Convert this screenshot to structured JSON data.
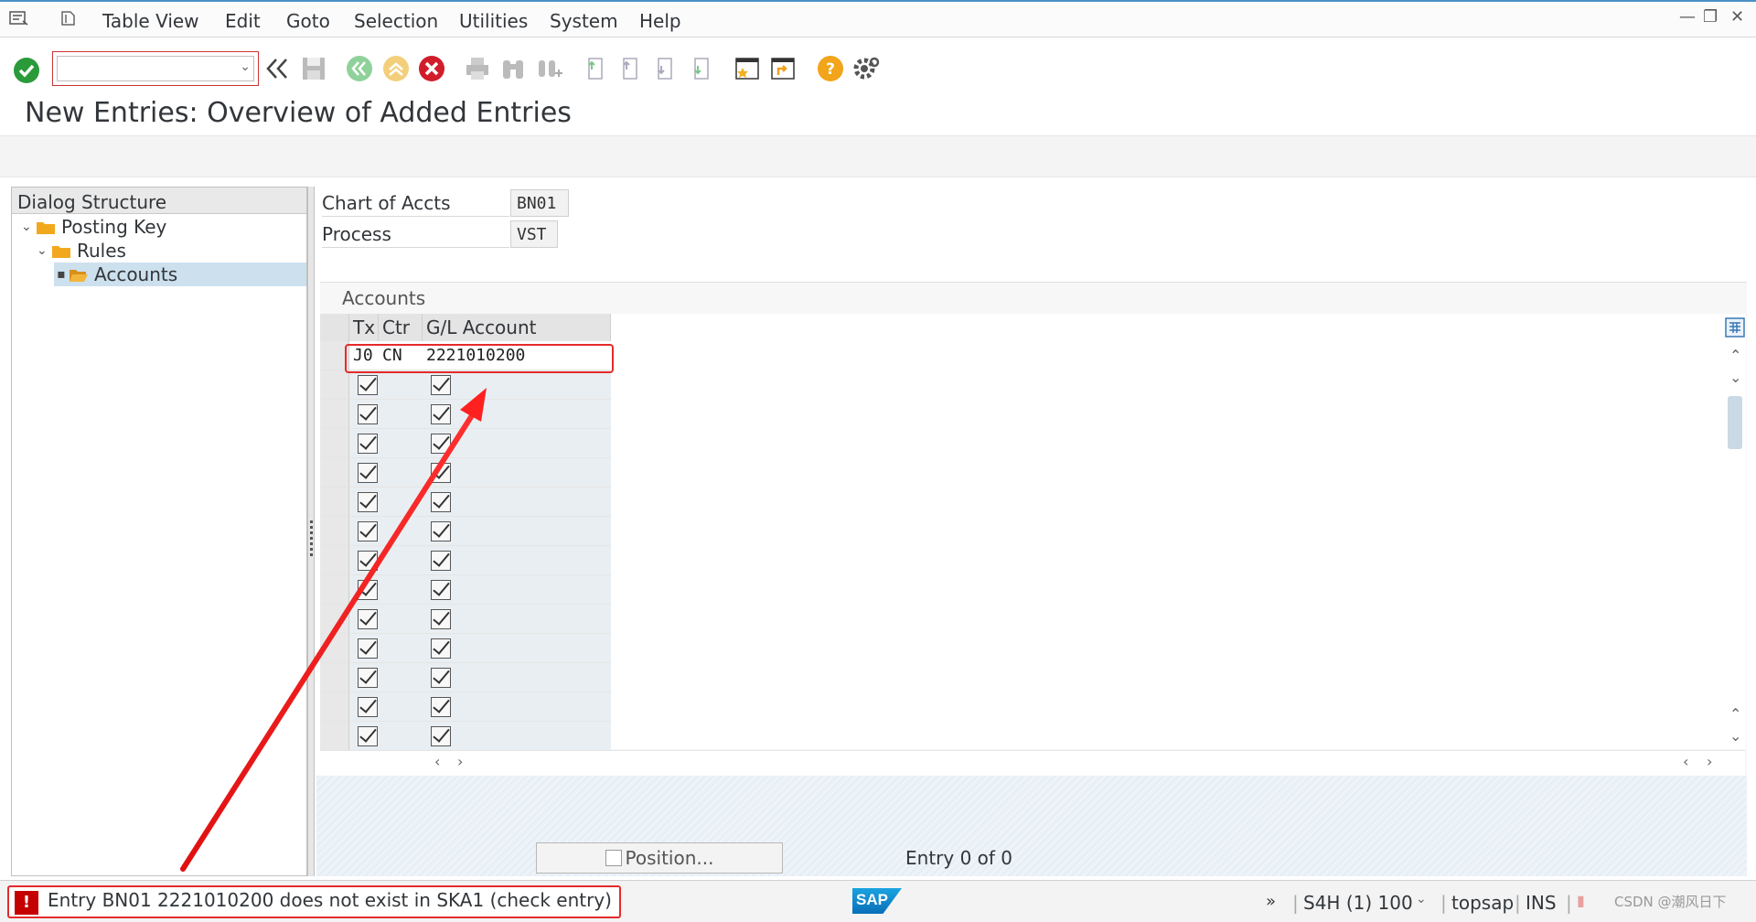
{
  "menu": {
    "items": [
      "Table View",
      "Edit",
      "Goto",
      "Selection",
      "Utilities",
      "System",
      "Help"
    ]
  },
  "toolbar": {
    "command_value": "",
    "icons": [
      "enter-icon",
      "back-double-icon",
      "save-icon",
      "back-icon",
      "exit-icon",
      "cancel-icon",
      "print-icon",
      "find-icon",
      "find-next-icon",
      "first-page-icon",
      "prev-page-icon",
      "next-page-icon",
      "last-page-icon",
      "create-session-icon",
      "shortcut-icon",
      "help-icon",
      "settings-icon"
    ]
  },
  "page": {
    "title": "New Entries: Overview of Added Entries"
  },
  "dialog_structure": {
    "header": "Dialog Structure",
    "items": [
      {
        "label": "Posting Key",
        "level": 1,
        "expanded": true
      },
      {
        "label": "Rules",
        "level": 2,
        "expanded": true
      },
      {
        "label": "Accounts",
        "level": 3,
        "selected": true
      }
    ]
  },
  "header_fields": {
    "chart_label": "Chart of Accts",
    "chart_value": "BN01",
    "process_label": "Process",
    "process_value": "VST"
  },
  "accounts": {
    "section_label": "Accounts",
    "columns": [
      "Tx",
      "Ctr",
      "G/L Account"
    ],
    "rows": [
      {
        "tx": "J0",
        "ctr": "CN",
        "gl": "2221010200"
      }
    ],
    "empty_rows": 13
  },
  "footer": {
    "position_label": "Position...",
    "entry_count": "Entry 0 of 0"
  },
  "statusbar": {
    "message": "Entry BN01 2221010200  does not exist in SKA1 (check entry)",
    "system": "S4H (1) 100",
    "user": "topsap",
    "mode": "INS",
    "watermark": "CSDN @潮风日下"
  },
  "colors": {
    "error": "#e52a2a",
    "selection": "#cde0ee",
    "accent": "#0a6fb8"
  }
}
